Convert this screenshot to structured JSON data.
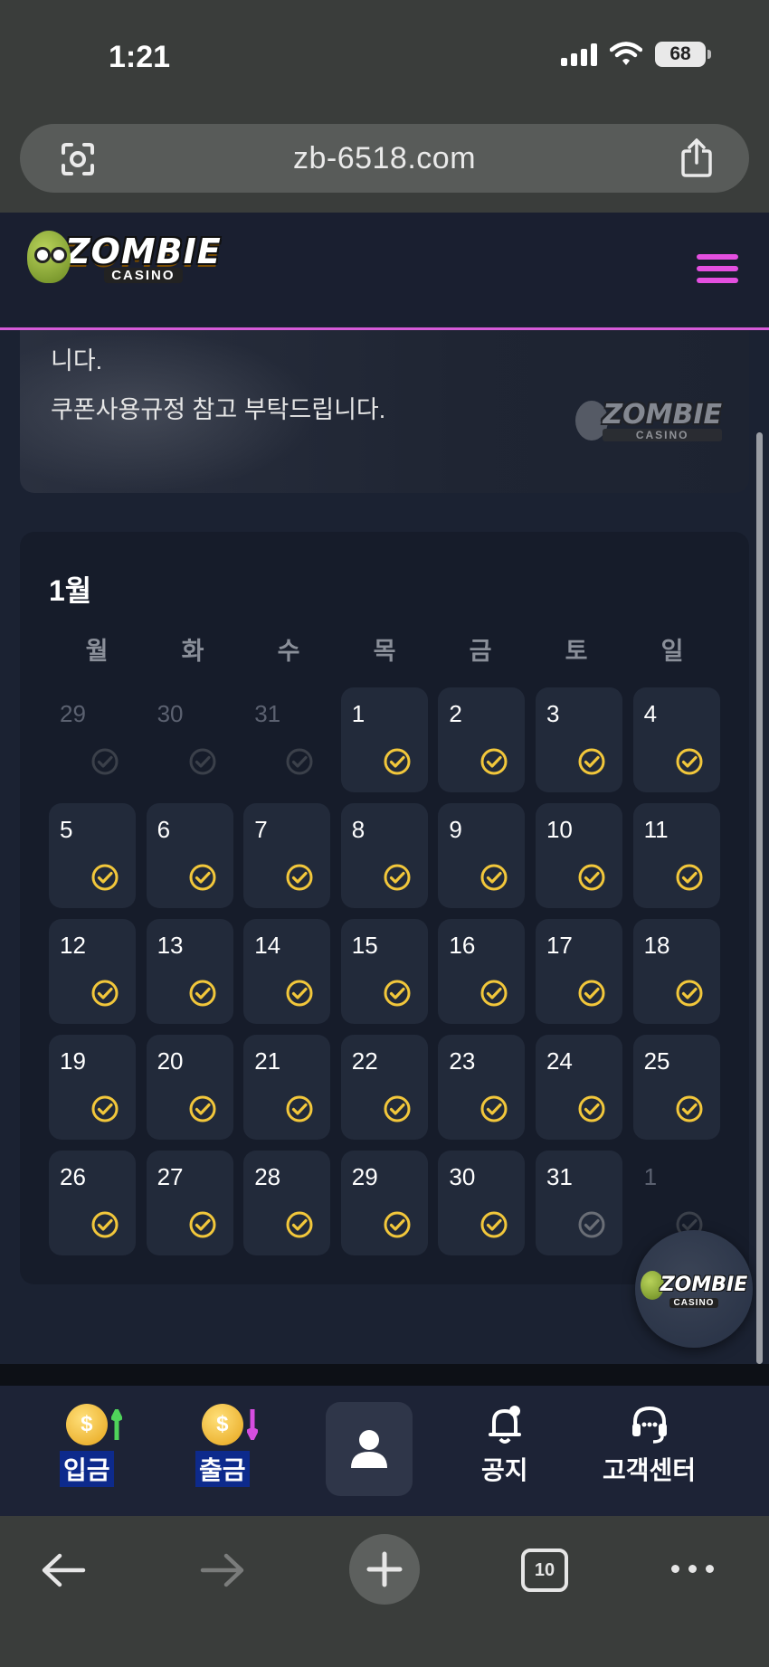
{
  "status_bar": {
    "time": "1:21",
    "battery": "68"
  },
  "browser": {
    "url": "zb-6518.com",
    "tabs_count": "10"
  },
  "site": {
    "logo_main": "ZOMBIE",
    "logo_sub": "CASINO"
  },
  "notice": {
    "line1": "니다.",
    "line2": "쿠폰사용규정 참고 부탁드립니다."
  },
  "calendar": {
    "month_label": "1월",
    "weekdays": [
      "월",
      "화",
      "수",
      "목",
      "금",
      "토",
      "일"
    ],
    "days": [
      {
        "num": "29",
        "in_month": false,
        "check": "dim"
      },
      {
        "num": "30",
        "in_month": false,
        "check": "dim"
      },
      {
        "num": "31",
        "in_month": false,
        "check": "dim"
      },
      {
        "num": "1",
        "in_month": true,
        "check": "gold"
      },
      {
        "num": "2",
        "in_month": true,
        "check": "gold"
      },
      {
        "num": "3",
        "in_month": true,
        "check": "gold"
      },
      {
        "num": "4",
        "in_month": true,
        "check": "gold"
      },
      {
        "num": "5",
        "in_month": true,
        "check": "gold"
      },
      {
        "num": "6",
        "in_month": true,
        "check": "gold"
      },
      {
        "num": "7",
        "in_month": true,
        "check": "gold"
      },
      {
        "num": "8",
        "in_month": true,
        "check": "gold"
      },
      {
        "num": "9",
        "in_month": true,
        "check": "gold"
      },
      {
        "num": "10",
        "in_month": true,
        "check": "gold"
      },
      {
        "num": "11",
        "in_month": true,
        "check": "gold"
      },
      {
        "num": "12",
        "in_month": true,
        "check": "gold"
      },
      {
        "num": "13",
        "in_month": true,
        "check": "gold"
      },
      {
        "num": "14",
        "in_month": true,
        "check": "gold"
      },
      {
        "num": "15",
        "in_month": true,
        "check": "gold"
      },
      {
        "num": "16",
        "in_month": true,
        "check": "gold"
      },
      {
        "num": "17",
        "in_month": true,
        "check": "gold"
      },
      {
        "num": "18",
        "in_month": true,
        "check": "gold"
      },
      {
        "num": "19",
        "in_month": true,
        "check": "gold"
      },
      {
        "num": "20",
        "in_month": true,
        "check": "gold"
      },
      {
        "num": "21",
        "in_month": true,
        "check": "gold"
      },
      {
        "num": "22",
        "in_month": true,
        "check": "gold"
      },
      {
        "num": "23",
        "in_month": true,
        "check": "gold"
      },
      {
        "num": "24",
        "in_month": true,
        "check": "gold"
      },
      {
        "num": "25",
        "in_month": true,
        "check": "gold"
      },
      {
        "num": "26",
        "in_month": true,
        "check": "gold"
      },
      {
        "num": "27",
        "in_month": true,
        "check": "gold"
      },
      {
        "num": "28",
        "in_month": true,
        "check": "gold"
      },
      {
        "num": "29",
        "in_month": true,
        "check": "gold"
      },
      {
        "num": "30",
        "in_month": true,
        "check": "gold"
      },
      {
        "num": "31",
        "in_month": true,
        "check": "gray"
      },
      {
        "num": "1",
        "in_month": false,
        "check": "dim"
      }
    ]
  },
  "bottom_nav": {
    "deposit": "입금",
    "withdraw": "출금",
    "notice": "공지",
    "support": "고객센터"
  },
  "colors": {
    "accent_pink": "#e44fe0",
    "check_gold": "#f2c73b",
    "label_box_blue": "#0d2a8c"
  },
  "icons": [
    "camera-search-icon",
    "share-icon",
    "hamburger-menu-icon",
    "check-circle-icon",
    "coin-up-icon",
    "coin-down-icon",
    "user-icon",
    "bell-icon",
    "headset-icon",
    "back-arrow-icon",
    "forward-arrow-icon",
    "plus-icon",
    "tabs-icon",
    "more-icon"
  ]
}
